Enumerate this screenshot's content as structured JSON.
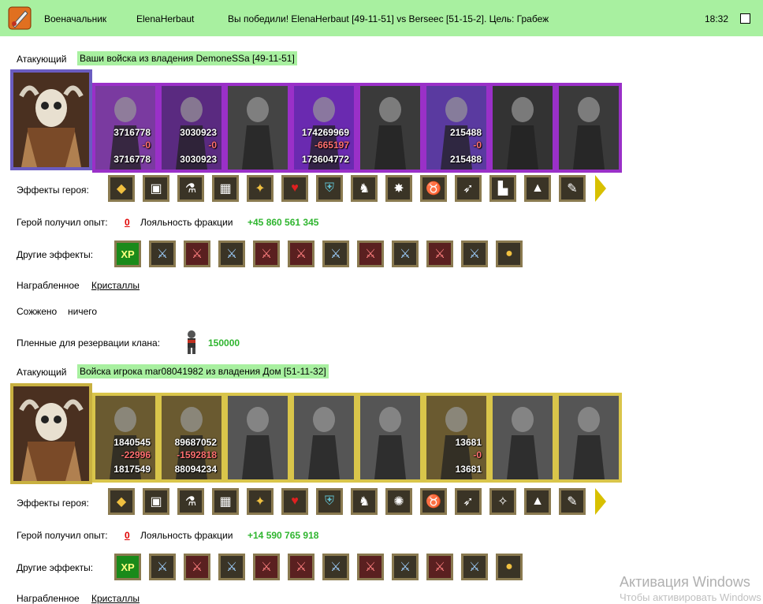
{
  "topbar": {
    "rank": "Военачальник",
    "player": "ElenaHerbaut",
    "result": "Вы победили! ElenaHerbaut [49-11-51] vs Berseec [51-15-2]. Цель: Грабеж",
    "time": "18:32",
    "accent": "#a8f0a0"
  },
  "sections": [
    {
      "attacker_label": "Атакующий",
      "army_title": "Ваши войска из владения DemoneSSa [49-11-51]",
      "frame_color": "#9a30c8",
      "units": [
        {
          "start": "3716778",
          "loss": "-0",
          "end": "3716778"
        },
        {
          "start": "3030923",
          "loss": "-0",
          "end": "3030923"
        },
        {
          "start": "",
          "loss": "",
          "end": ""
        },
        {
          "start": "174269969",
          "loss": "-665197",
          "end": "173604772"
        },
        {
          "start": "",
          "loss": "",
          "end": ""
        },
        {
          "start": "215488",
          "loss": "-0",
          "end": "215488"
        },
        {
          "start": "",
          "loss": "",
          "end": ""
        },
        {
          "start": "",
          "loss": "",
          "end": ""
        }
      ],
      "hero_effects_label": "Эффекты героя:",
      "hero_effects": [
        "gold-chest-icon",
        "armor-icon",
        "potion-icon",
        "gift-icon",
        "treasure-icon",
        "heart-icon",
        "shield-icon",
        "beast-icon",
        "star-icon",
        "horns-icon",
        "bow-icon",
        "boots-icon",
        "pyramid-icon",
        "scroll-icon"
      ],
      "exp_label": "Герой получил опыт:",
      "exp_value": "0",
      "loyalty_label": "Лояльность фракции",
      "loyalty_value": "+45 860 561 345",
      "other_effects_label": "Другие эффекты:",
      "other_effects": [
        "xp",
        "sword",
        "rsword",
        "sword",
        "rsword",
        "rsword",
        "sword",
        "rsword",
        "sword",
        "rsword",
        "sword",
        "gold"
      ],
      "xp_text": "XP",
      "loot_label": "Награбленное",
      "loot_value": "Кристаллы",
      "burned_label": "Сожжено",
      "burned_value": "ничего",
      "prisoners_label": "Пленные для резервации клана:",
      "prisoners_value": "150000"
    },
    {
      "attacker_label": "Атакующий",
      "army_title": "Войска игрока mar08041982 из владения Дом [51-11-32]",
      "frame_color": "#d9c54a",
      "units": [
        {
          "start": "1840545",
          "loss": "-22996",
          "end": "1817549"
        },
        {
          "start": "89687052",
          "loss": "-1592818",
          "end": "88094234"
        },
        {
          "start": "",
          "loss": "",
          "end": ""
        },
        {
          "start": "",
          "loss": "",
          "end": ""
        },
        {
          "start": "",
          "loss": "",
          "end": ""
        },
        {
          "start": "13681",
          "loss": "-0",
          "end": "13681"
        },
        {
          "start": "",
          "loss": "",
          "end": ""
        },
        {
          "start": "",
          "loss": "",
          "end": ""
        }
      ],
      "hero_effects_label": "Эффекты героя:",
      "hero_effects": [
        "gold-chest-icon",
        "armor-icon",
        "potion-icon",
        "gift-icon",
        "treasure-icon",
        "heart-icon",
        "shield-icon",
        "beast-icon",
        "amulet-icon",
        "horns-icon",
        "bow-icon",
        "wings-icon",
        "pyramid-icon",
        "scroll-icon"
      ],
      "exp_label": "Герой получил опыт:",
      "exp_value": "0",
      "loyalty_label": "Лояльность фракции",
      "loyalty_value": "+14 590 765 918",
      "other_effects_label": "Другие эффекты:",
      "other_effects": [
        "xp",
        "sword",
        "rsword",
        "sword",
        "rsword",
        "rsword",
        "sword",
        "rsword",
        "sword",
        "rsword",
        "sword",
        "gold"
      ],
      "xp_text": "XP",
      "loot_label": "Награбленное",
      "loot_value": "Кристаллы"
    }
  ],
  "watermark": {
    "line1": "Активация Windows",
    "line2": "Чтобы активировать Windows"
  }
}
